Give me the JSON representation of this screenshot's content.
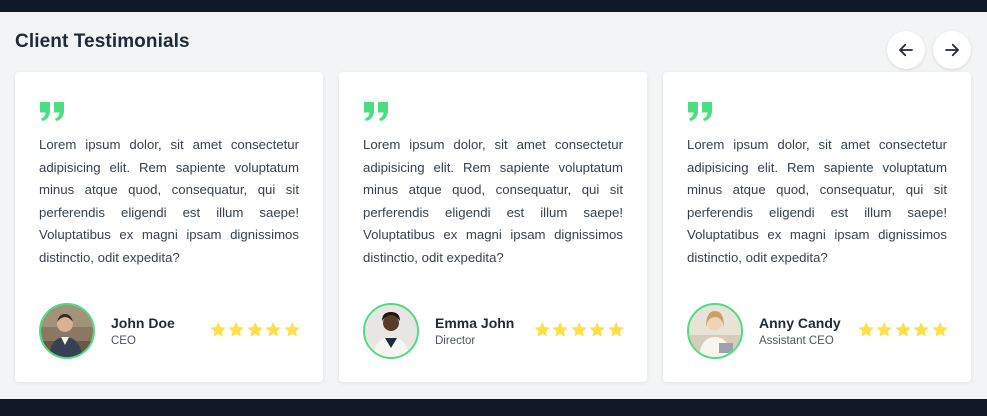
{
  "section": {
    "title": "Client Testimonials"
  },
  "navigation": {
    "prev_icon": "arrow-left-icon",
    "next_icon": "arrow-right-icon"
  },
  "colors": {
    "accent_green": "#4ade80",
    "star_yellow": "#fde047",
    "dark_bar": "#111827",
    "background": "#f3f4f6"
  },
  "testimonials": [
    {
      "text": "Lorem ipsum dolor, sit amet consectetur adipisicing elit. Rem sapiente voluptatum minus atque quod, consequatur, qui sit perferendis eligendi est illum saepe! Voluptatibus ex magni ipsam dignissimos distinctio, odit expedita?",
      "name": "John Doe",
      "role": "CEO",
      "rating": 5,
      "rating_max": 5
    },
    {
      "text": "Lorem ipsum dolor, sit amet consectetur adipisicing elit. Rem sapiente voluptatum minus atque quod, consequatur, qui sit perferendis eligendi est illum saepe! Voluptatibus ex magni ipsam dignissimos distinctio, odit expedita?",
      "name": "Emma John",
      "role": "Director",
      "rating": 5,
      "rating_max": 5
    },
    {
      "text": "Lorem ipsum dolor, sit amet consectetur adipisicing elit. Rem sapiente voluptatum minus atque quod, consequatur, qui sit perferendis eligendi est illum saepe! Voluptatibus ex magni ipsam dignissimos distinctio, odit expedita?",
      "name": "Anny Candy",
      "role": "Assistant CEO",
      "rating": 5,
      "rating_max": 5
    }
  ]
}
